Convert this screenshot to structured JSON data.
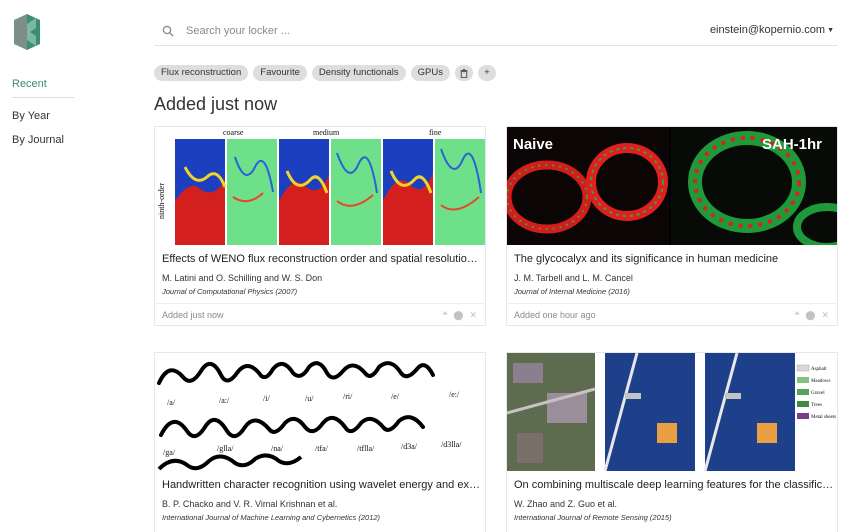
{
  "sidebar": {
    "nav": [
      {
        "label": "Recent",
        "active": true
      },
      {
        "label": "By Year",
        "active": false
      },
      {
        "label": "By Journal",
        "active": false
      }
    ]
  },
  "topbar": {
    "search_placeholder": "Search your locker ...",
    "user_email": "einstein@kopernio.com"
  },
  "tags": [
    "Flux reconstruction",
    "Favourite",
    "Density functionals",
    "GPUs"
  ],
  "section_title": "Added just now",
  "cards": [
    {
      "title": "Effects of WENO flux reconstruction order and spatial resolution o...",
      "authors": "M. Latini and O. Schilling and W. S. Don",
      "journal": "Journal of Computational Physics (2007)",
      "added": "Added just now",
      "figure": {
        "col_labels": [
          "coarse",
          "medium",
          "fine"
        ],
        "row_label": "ninth-order"
      }
    },
    {
      "title": "The glycocalyx and its significance in human medicine",
      "authors": "J. M. Tarbell and L. M. Cancel",
      "journal": "Journal of Internal Medicine (2016)",
      "added": "Added one hour ago",
      "figure": {
        "left_label": "Naive",
        "right_label": "SAH-1hr"
      }
    },
    {
      "title": "Handwritten character recognition using wavelet energy and extre...",
      "authors": "B. P. Chacko and V. R. Vimal Krishnan et al.",
      "journal": "International Journal of Machine Learning and Cybernetics (2012)",
      "figure": {
        "row1": [
          "/a/",
          "/a:/",
          "/i/",
          "/u/",
          "/ri/",
          "/e/",
          "/e:/"
        ],
        "row2": [
          "/ga/",
          "/glla/",
          "/na/",
          "/tfa/",
          "/tflla/",
          "/d3a/",
          "/d3lla/"
        ]
      }
    },
    {
      "title": "On combining multiscale deep learning features for the classificati...",
      "authors": "W. Zhao and Z. Guo et al.",
      "journal": "International Journal of Remote Sensing (2015)",
      "figure": {
        "legend": [
          "Asphalt",
          "Meadows",
          "Gravel",
          "Trees",
          "Metal sheets"
        ]
      }
    }
  ],
  "colors": {
    "accent": "#3a8f73",
    "tag_bg": "#dedede"
  }
}
